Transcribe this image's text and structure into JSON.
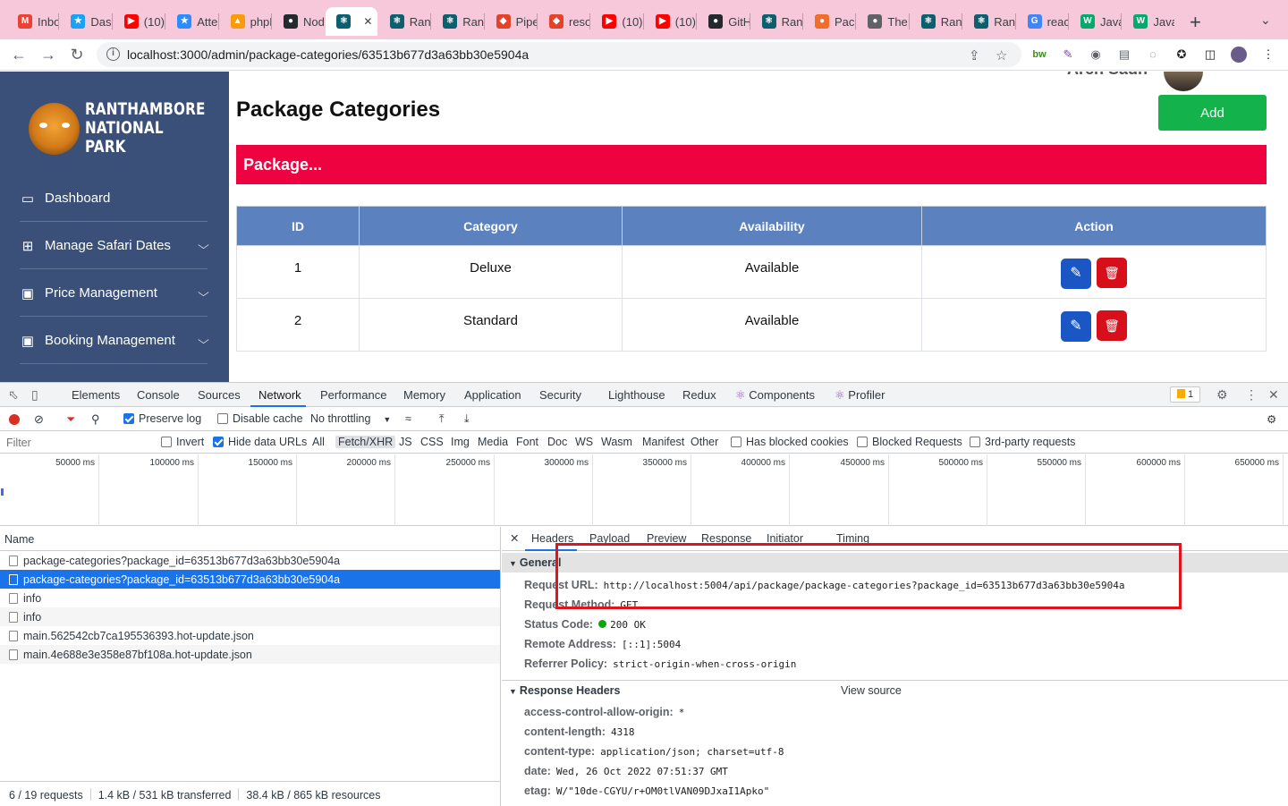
{
  "browser": {
    "tabs": [
      {
        "title": "Inbox",
        "color": "#ea4335",
        "glyph": "M"
      },
      {
        "title": "Dashboard",
        "color": "#1da1f2",
        "glyph": "★"
      },
      {
        "title": "(10)",
        "color": "#ff0000",
        "glyph": "▶"
      },
      {
        "title": "Attendance",
        "color": "#2d8cff",
        "glyph": "★"
      },
      {
        "title": "phpMyAdmin",
        "color": "#f89c0e",
        "glyph": "▲"
      },
      {
        "title": "Node",
        "color": "#24292f",
        "glyph": "●"
      },
      {
        "title": "",
        "color": "#0b5f6e",
        "glyph": "⚛"
      },
      {
        "title": "Ranthambore",
        "color": "#0b5f6e",
        "glyph": "⚛"
      },
      {
        "title": "Ranthambore",
        "color": "#0b5f6e",
        "glyph": "⚛"
      },
      {
        "title": "Pipelines",
        "color": "#e24329",
        "glyph": "◆"
      },
      {
        "title": "resources",
        "color": "#e24329",
        "glyph": "◆"
      },
      {
        "title": "(10)",
        "color": "#ff0000",
        "glyph": "▶"
      },
      {
        "title": "(10)",
        "color": "#ff0000",
        "glyph": "▶"
      },
      {
        "title": "GitHub",
        "color": "#24292f",
        "glyph": "●"
      },
      {
        "title": "Ranthambore",
        "color": "#0b5f6e",
        "glyph": "⚛"
      },
      {
        "title": "Packages",
        "color": "#f16d2b",
        "glyph": "●"
      },
      {
        "title": "The",
        "color": "#5f6368",
        "glyph": "●"
      },
      {
        "title": "Ranthambore",
        "color": "#0b5f6e",
        "glyph": "⚛"
      },
      {
        "title": "Ranthambore",
        "color": "#0b5f6e",
        "glyph": "⚛"
      },
      {
        "title": "react",
        "color": "#4285f4",
        "glyph": "G"
      },
      {
        "title": "JavaScript",
        "color": "#04aa6d",
        "glyph": "W"
      },
      {
        "title": "JavaScript",
        "color": "#04aa6d",
        "glyph": "W"
      }
    ],
    "active_tab_close": "✕",
    "new_tab": "+",
    "url": "localhost:3000/admin/package-categories/63513b677d3a63bb30e5904a"
  },
  "sidebar": {
    "brand": [
      "RANTHAMBORE",
      "NATIONAL PARK"
    ],
    "items": [
      {
        "label": "Dashboard",
        "icon": "monitor-icon",
        "glyph": "▭",
        "has_dropdown": false
      },
      {
        "label": "Manage Safari Dates",
        "icon": "grid-icon",
        "glyph": "⊞",
        "has_dropdown": true
      },
      {
        "label": "Price Management",
        "icon": "briefcase-icon",
        "glyph": "▣",
        "has_dropdown": true
      },
      {
        "label": "Booking Management",
        "icon": "briefcase-icon",
        "glyph": "▣",
        "has_dropdown": true
      }
    ]
  },
  "main": {
    "title": "Package Categories",
    "user_name": "Arch Sadh",
    "add_label": "Add",
    "banner": "Package...",
    "table": {
      "headers": [
        "ID",
        "Category",
        "Availability",
        "Action"
      ],
      "rows": [
        {
          "id": "1",
          "category": "Deluxe",
          "availability": "Available"
        },
        {
          "id": "2",
          "category": "Standard",
          "availability": "Available"
        }
      ]
    },
    "colors": {
      "sidebar": "#3a5078",
      "add": "#13b24a",
      "banner": "#ef0240",
      "table_head": "#5b81bf",
      "edit": "#1a56c4",
      "delete": "#d70f1b"
    }
  },
  "devtools": {
    "tabs": [
      "Elements",
      "Console",
      "Sources",
      "Network",
      "Performance",
      "Memory",
      "Application",
      "Security",
      "Lighthouse",
      "Redux",
      "Components",
      "Profiler"
    ],
    "active_tab": "Network",
    "issues_count": "1",
    "controls": {
      "preserve_log": "Preserve log",
      "disable_cache": "Disable cache",
      "throttling": "No throttling"
    },
    "filter": {
      "placeholder": "Filter",
      "invert": "Invert",
      "hide_data_urls": "Hide data URLs",
      "types": [
        "All",
        "Fetch/XHR",
        "JS",
        "CSS",
        "Img",
        "Media",
        "Font",
        "Doc",
        "WS",
        "Wasm",
        "Manifest",
        "Other"
      ],
      "selected_type": "Fetch/XHR",
      "has_blocked_cookies": "Has blocked cookies",
      "blocked_requests": "Blocked Requests",
      "third_party": "3rd-party requests"
    },
    "timeline_ticks": [
      "50000 ms",
      "100000 ms",
      "150000 ms",
      "200000 ms",
      "250000 ms",
      "300000 ms",
      "350000 ms",
      "400000 ms",
      "450000 ms",
      "500000 ms",
      "550000 ms",
      "600000 ms",
      "650000 ms"
    ],
    "name_header": "Name",
    "requests": [
      "package-categories?package_id=63513b677d3a63bb30e5904a",
      "package-categories?package_id=63513b677d3a63bb30e5904a",
      "info",
      "info",
      "main.562542cb7ca195536393.hot-update.json",
      "main.4e688e3e358e87bf108a.hot-update.json"
    ],
    "selected_request": 1,
    "status_bar": [
      "6 / 19 requests",
      "1.4 kB / 531 kB transferred",
      "38.4 kB / 865 kB resources"
    ],
    "detail_tabs": [
      "Headers",
      "Payload",
      "Preview",
      "Response",
      "Initiator",
      "Timing"
    ],
    "general": {
      "title": "General",
      "rows": [
        {
          "k": "Request URL:",
          "v": "http://localhost:5004/api/package/package-categories?package_id=63513b677d3a63bb30e5904a"
        },
        {
          "k": "Request Method:",
          "v": "GET"
        },
        {
          "k": "Status Code:",
          "v": "200 OK"
        },
        {
          "k": "Remote Address:",
          "v": "[::1]:5004"
        },
        {
          "k": "Referrer Policy:",
          "v": "strict-origin-when-cross-origin"
        }
      ]
    },
    "response_headers": {
      "title": "Response Headers",
      "view_source": "View source",
      "rows": [
        {
          "k": "access-control-allow-origin:",
          "v": "*"
        },
        {
          "k": "content-length:",
          "v": "4318"
        },
        {
          "k": "content-type:",
          "v": "application/json; charset=utf-8"
        },
        {
          "k": "date:",
          "v": "Wed, 26 Oct 2022 07:51:37 GMT"
        },
        {
          "k": "etag:",
          "v": "W/\"10de-CGYU/r+OM0tlVAN09DJxaI1Apko\""
        }
      ]
    }
  }
}
